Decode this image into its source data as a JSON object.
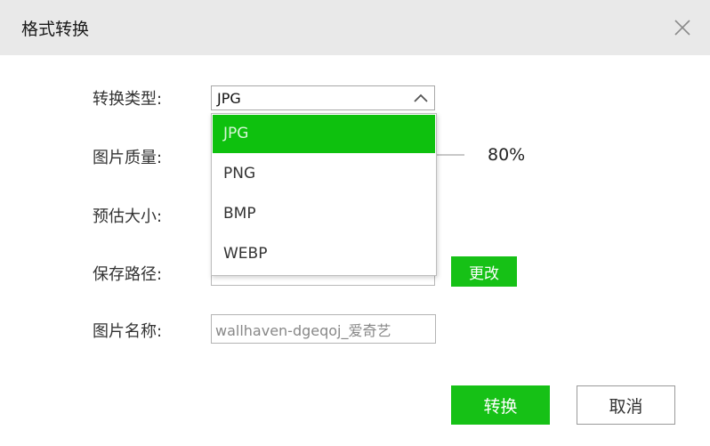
{
  "dialog": {
    "title": "格式转换",
    "close_icon": "close-icon"
  },
  "form": {
    "type_label": "转换类型:",
    "quality_label": "图片质量:",
    "estimate_label": "预估大小:",
    "path_label": "保存路径:",
    "name_label": "图片名称:",
    "type_select": {
      "value": "JPG",
      "icon": "chevron-up-icon",
      "options": [
        "JPG",
        "PNG",
        "BMP",
        "WEBP"
      ],
      "selected_index": 0
    },
    "quality_value": "80%",
    "path_change_label": "更改",
    "name_value": "wallhaven-dgeqoj_爱奇艺"
  },
  "actions": {
    "convert_label": "转换",
    "cancel_label": "取消"
  },
  "colors": {
    "accent": "#16c116",
    "titlebar": "#e9e9e9"
  }
}
